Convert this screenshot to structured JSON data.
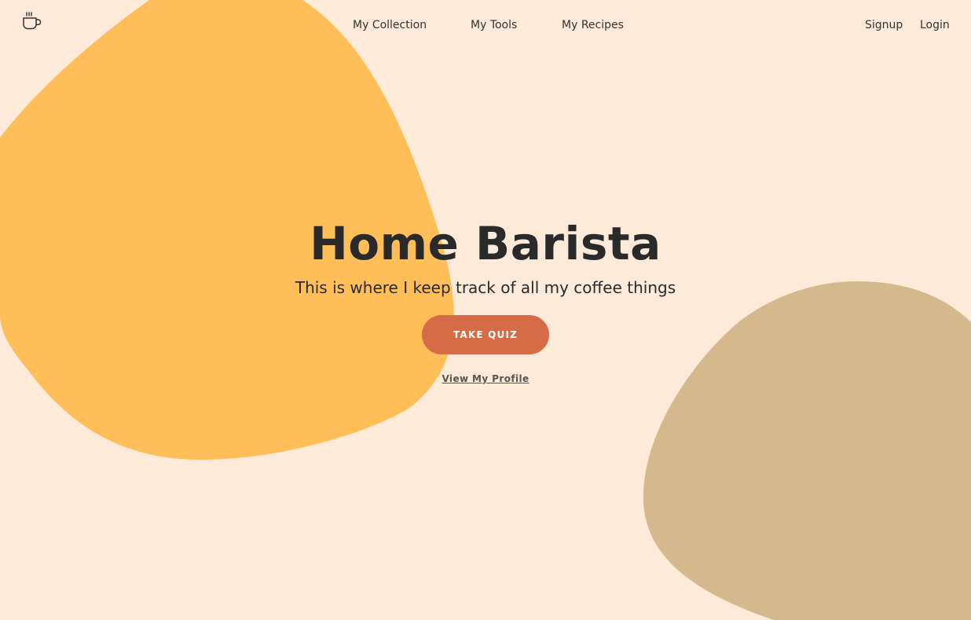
{
  "colors": {
    "background": "#FDEAD8",
    "blob_primary": "#FFBE58",
    "blob_secondary": "#D3B98C",
    "accent": "#D66B47",
    "text": "#2a2a2a"
  },
  "header": {
    "logo_icon": "coffee-cup-icon",
    "nav": [
      {
        "label": "My Collection"
      },
      {
        "label": "My Tools"
      },
      {
        "label": "My Recipes"
      }
    ],
    "auth": {
      "signup_label": "Signup",
      "login_label": "Login"
    }
  },
  "hero": {
    "title": "Home Barista",
    "subtitle": "This is where I keep track of all my coffee things",
    "cta_label": "TAKE QUIZ",
    "secondary_link": "View My Profile"
  }
}
